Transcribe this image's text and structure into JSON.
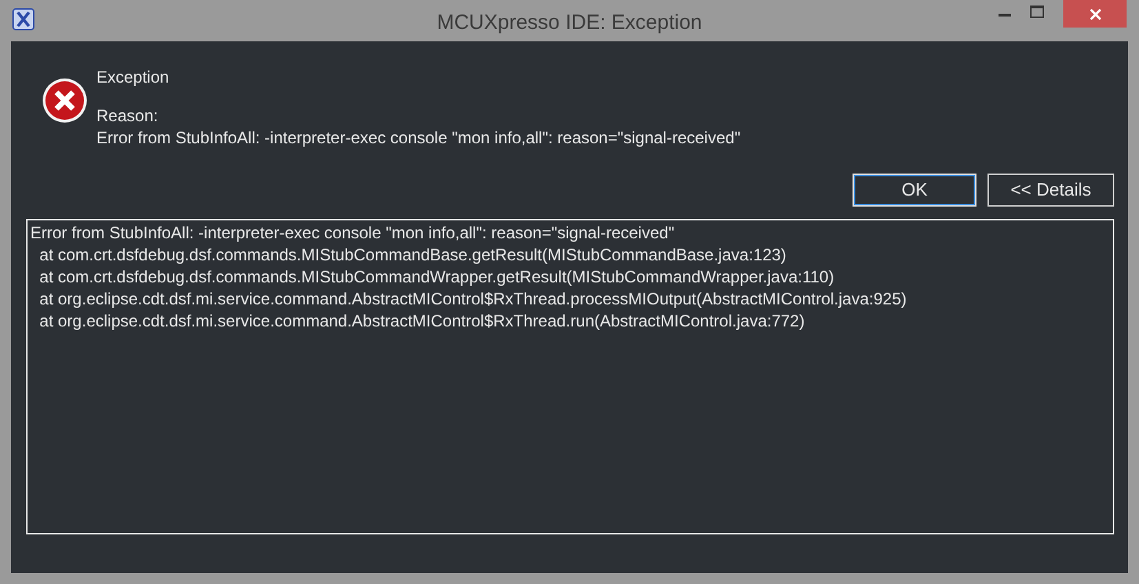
{
  "window": {
    "title": "MCUXpresso IDE: Exception"
  },
  "message": {
    "heading": "Exception",
    "reason_label": "Reason:",
    "reason": "Error from StubInfoAll: -interpreter-exec console \"mon info,all\": reason=\"signal-received\""
  },
  "buttons": [
    {
      "label": "OK",
      "focused": true
    },
    {
      "label": "<< Details",
      "focused": false
    }
  ],
  "details": [
    "Error from StubInfoAll: -interpreter-exec console \"mon info,all\": reason=\"signal-received\"",
    "  at com.crt.dsfdebug.dsf.commands.MIStubCommandBase.getResult(MIStubCommandBase.java:123)",
    "  at com.crt.dsfdebug.dsf.commands.MIStubCommandWrapper.getResult(MIStubCommandWrapper.java:110)",
    "  at org.eclipse.cdt.dsf.mi.service.command.AbstractMIControl$RxThread.processMIOutput(AbstractMIControl.java:925)",
    "  at org.eclipse.cdt.dsf.mi.service.command.AbstractMIControl$RxThread.run(AbstractMIControl.java:772)"
  ]
}
